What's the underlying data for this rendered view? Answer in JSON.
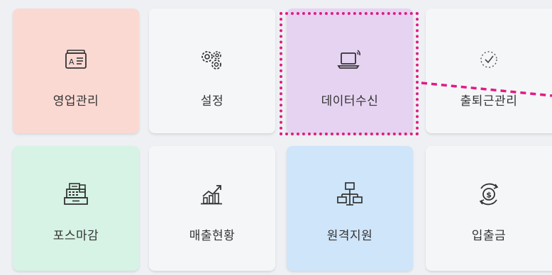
{
  "tiles": [
    {
      "label": "영업관리",
      "icon": "id-card-icon",
      "bg": "#fbd9d3"
    },
    {
      "label": "설정",
      "icon": "gears-icon",
      "bg": "#f5f6f8"
    },
    {
      "label": "데이터수신",
      "icon": "laptop-signal-icon",
      "bg": "#e6d3f1"
    },
    {
      "label": "출퇴근관리",
      "icon": "clock-check-icon",
      "bg": "#f5f6f8"
    },
    {
      "label": "포스마감",
      "icon": "cash-register-icon",
      "bg": "#d6f3e5"
    },
    {
      "label": "매출현황",
      "icon": "growth-chart-icon",
      "bg": "#f5f6f8"
    },
    {
      "label": "원격지원",
      "icon": "network-icon",
      "bg": "#cfe5f9"
    },
    {
      "label": "입출금",
      "icon": "money-cycle-icon",
      "bg": "#f5f6f8"
    }
  ],
  "highlight": {
    "color": "#e01b84",
    "target": "데이터수신"
  }
}
